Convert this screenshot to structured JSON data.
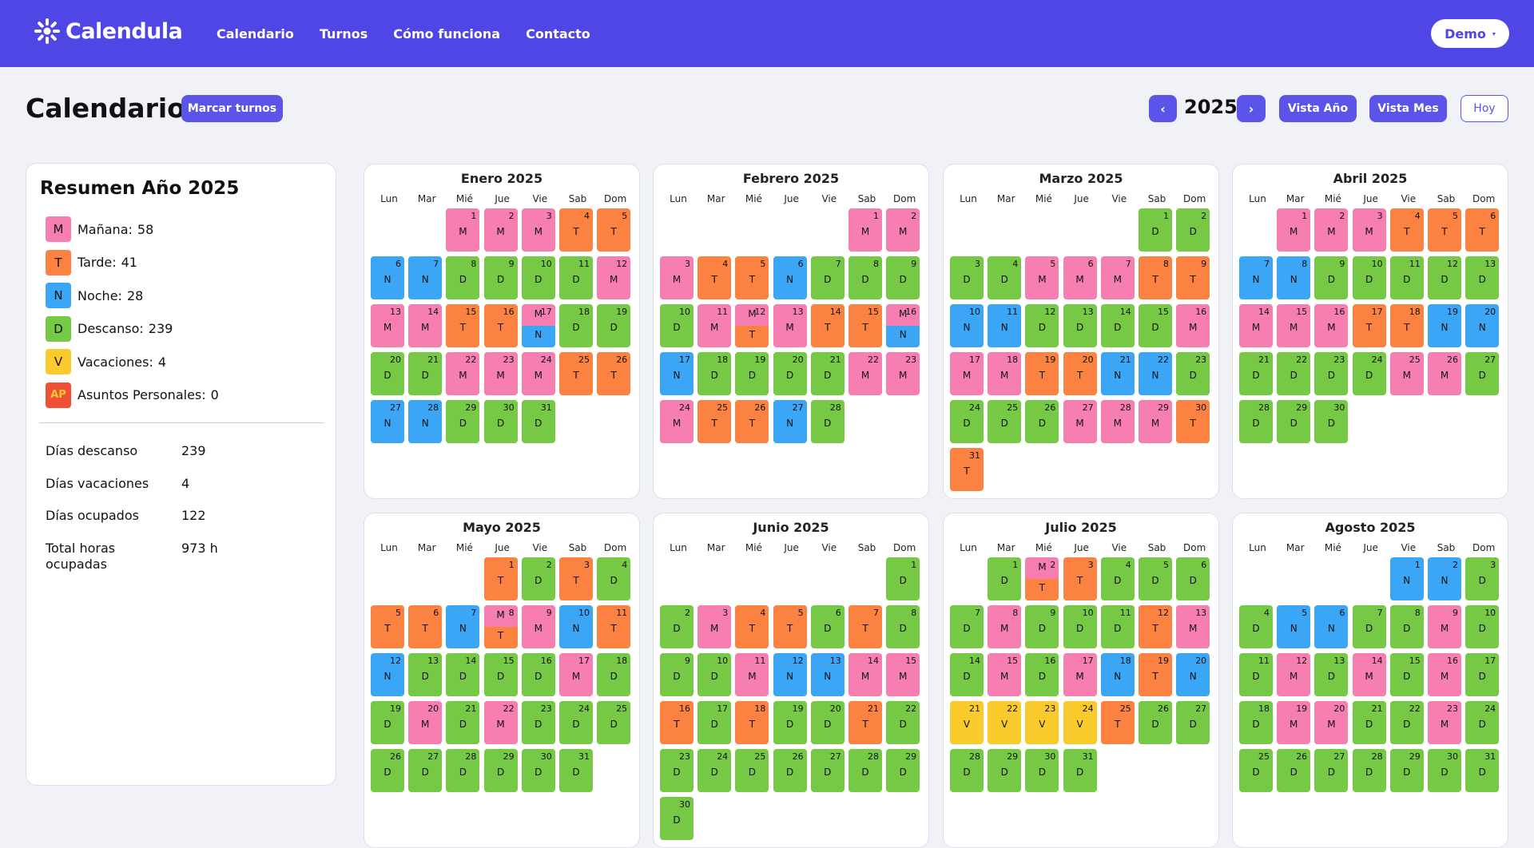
{
  "nav": {
    "brand": "Calendula",
    "links": [
      "Calendario",
      "Turnos",
      "Cómo funciona",
      "Contacto"
    ],
    "user_menu": "Demo",
    "user_caret": "▾"
  },
  "page": {
    "title": "Calendario",
    "mark_button": "Marcar turnos",
    "prev": "‹",
    "next": "›",
    "year": "2025",
    "view_year": "Vista Año",
    "view_month": "Vista Mes",
    "today": "Hoy"
  },
  "summary": {
    "title": "Resumen Año 2025",
    "legend": [
      {
        "code": "M",
        "label": "Mañana:",
        "count": "58",
        "color": "#f67eb0"
      },
      {
        "code": "T",
        "label": "Tarde:",
        "count": "41",
        "color": "#fb8240"
      },
      {
        "code": "N",
        "label": "Noche:",
        "count": "28",
        "color": "#3aa6f5"
      },
      {
        "code": "D",
        "label": "Descanso:",
        "count": "239",
        "color": "#76c944"
      },
      {
        "code": "V",
        "label": "Vacaciones:",
        "count": "4",
        "color": "#fbcb2e"
      },
      {
        "code": "AP",
        "label": "Asuntos Personales:",
        "count": "0",
        "color": "#f04e37"
      }
    ],
    "stats": [
      {
        "label": "Días descanso",
        "value": "239"
      },
      {
        "label": "Días vacaciones",
        "value": "4"
      },
      {
        "label": "Días ocupados",
        "value": "122"
      },
      {
        "label": "Total horas ocupadas",
        "value": "973 h"
      }
    ]
  },
  "weekdays": [
    "Lun",
    "Mar",
    "Mié",
    "Jue",
    "Vie",
    "Sab",
    "Dom"
  ],
  "months": [
    {
      "name": "Enero 2025",
      "start": 2,
      "days": [
        "M",
        "M",
        "M",
        "T",
        "T",
        "N",
        "N",
        "D",
        "D",
        "D",
        "D",
        "M",
        "M",
        "M",
        "T",
        "T",
        "M/N",
        "D",
        "D",
        "D",
        "D",
        "M",
        "M",
        "M",
        "T",
        "T",
        "N",
        "N",
        "D",
        "D",
        "D"
      ]
    },
    {
      "name": "Febrero 2025",
      "start": 5,
      "days": [
        "M",
        "M",
        "M",
        "T",
        "T",
        "N",
        "D",
        "D",
        "D",
        "D",
        "M",
        "M/T",
        "M",
        "T",
        "T",
        "M/N",
        "N",
        "D",
        "D",
        "D",
        "D",
        "M",
        "M",
        "M",
        "T",
        "T",
        "N",
        "D"
      ]
    },
    {
      "name": "Marzo 2025",
      "start": 5,
      "days": [
        "D",
        "D",
        "D",
        "D",
        "M",
        "M",
        "M",
        "T",
        "T",
        "N",
        "N",
        "D",
        "D",
        "D",
        "D",
        "M",
        "M",
        "M",
        "T",
        "T",
        "N",
        "N",
        "D",
        "D",
        "D",
        "D",
        "M",
        "M",
        "M",
        "T",
        "T"
      ]
    },
    {
      "name": "Abril 2025",
      "start": 1,
      "days": [
        "M",
        "M",
        "M",
        "T",
        "T",
        "T",
        "N",
        "N",
        "D",
        "D",
        "D",
        "D",
        "D",
        "M",
        "M",
        "M",
        "T",
        "T",
        "N",
        "N",
        "D",
        "D",
        "D",
        "D",
        "M",
        "M",
        "D",
        "D",
        "D",
        "D"
      ]
    },
    {
      "name": "Mayo 2025",
      "start": 3,
      "days": [
        "T",
        "D",
        "T",
        "D",
        "T",
        "T",
        "N",
        "M/T",
        "M",
        "N",
        "T",
        "N",
        "D",
        "D",
        "D",
        "D",
        "M",
        "D",
        "D",
        "M",
        "D",
        "M",
        "D",
        "D",
        "D",
        "D",
        "D",
        "D",
        "D",
        "D",
        "D"
      ]
    },
    {
      "name": "Junio 2025",
      "start": 6,
      "days": [
        "D",
        "D",
        "M",
        "T",
        "T",
        "D",
        "T",
        "D",
        "D",
        "D",
        "M",
        "N",
        "N",
        "M",
        "M",
        "T",
        "D",
        "T",
        "D",
        "D",
        "T",
        "D",
        "D",
        "D",
        "D",
        "D",
        "D",
        "D",
        "D",
        "D"
      ]
    },
    {
      "name": "Julio 2025",
      "start": 1,
      "days": [
        "D",
        "M/T",
        "T",
        "D",
        "D",
        "D",
        "D",
        "M",
        "D",
        "D",
        "D",
        "T",
        "M",
        "D",
        "M",
        "D",
        "M",
        "N",
        "T",
        "N",
        "V",
        "V",
        "V",
        "V",
        "T",
        "D",
        "D",
        "D",
        "D",
        "D",
        "D"
      ]
    },
    {
      "name": "Agosto 2025",
      "start": 4,
      "days": [
        "N",
        "N",
        "D",
        "D",
        "N",
        "N",
        "D",
        "D",
        "M",
        "D",
        "D",
        "M",
        "D",
        "M",
        "D",
        "M",
        "D",
        "D",
        "M",
        "M",
        "D",
        "D",
        "M",
        "D",
        "D",
        "D",
        "D",
        "D",
        "D",
        "D",
        "D"
      ]
    }
  ]
}
